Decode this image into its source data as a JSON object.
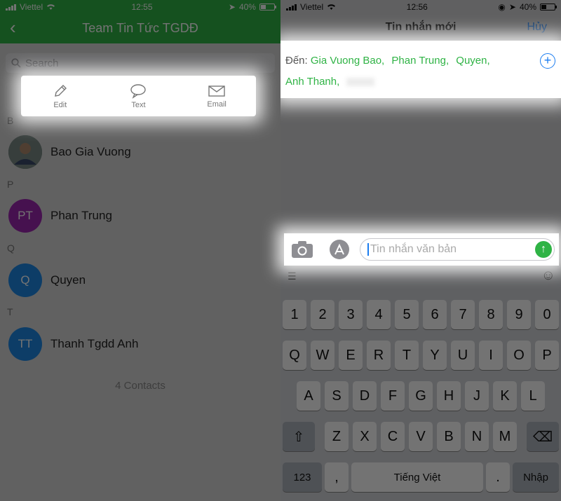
{
  "left": {
    "status": {
      "carrier": "Viettel",
      "time": "12:55",
      "battery": "40%"
    },
    "header": {
      "title": "Team Tin Tức TGDĐ",
      "back": "‹"
    },
    "search": {
      "placeholder": "Search"
    },
    "actions": [
      {
        "label": "Edit",
        "icon": "pencil-icon"
      },
      {
        "label": "Text",
        "icon": "chat-bubble-icon"
      },
      {
        "label": "Email",
        "icon": "envelope-icon"
      }
    ],
    "sections": [
      {
        "letter": "B",
        "contact": {
          "name": "Bao Gia Vuong",
          "initials": "",
          "color": "#6d7d7a",
          "photo": true
        }
      },
      {
        "letter": "P",
        "contact": {
          "name": "Phan Trung",
          "initials": "PT",
          "color": "#9c27b0",
          "photo": false
        }
      },
      {
        "letter": "Q",
        "contact": {
          "name": "Quyen",
          "initials": "Q",
          "color": "#1e88e5",
          "photo": false
        }
      },
      {
        "letter": "T",
        "contact": {
          "name": "Thanh Tgdd Anh",
          "initials": "TT",
          "color": "#1e88e5",
          "photo": false
        }
      }
    ],
    "contacts_count": "4 Contacts"
  },
  "right": {
    "status": {
      "carrier": "Viettel",
      "time": "12:56",
      "battery": "40%"
    },
    "nav": {
      "title": "Tin nhắn mới",
      "cancel": "Hủy"
    },
    "to": {
      "label": "Đến:",
      "recipients": [
        "Gia Vuong Bao,",
        "Phan Trung,",
        "Quyen,",
        "Anh Thanh,"
      ]
    },
    "compose": {
      "placeholder": "Tin nhắn văn bản"
    },
    "keyboard": {
      "row_numbers": [
        "1",
        "2",
        "3",
        "4",
        "5",
        "6",
        "7",
        "8",
        "9",
        "0"
      ],
      "row_q": [
        "Q",
        "W",
        "E",
        "R",
        "T",
        "Y",
        "U",
        "I",
        "O",
        "P"
      ],
      "row_a": [
        "A",
        "S",
        "D",
        "F",
        "G",
        "H",
        "J",
        "K",
        "L"
      ],
      "row_z": [
        "Z",
        "X",
        "C",
        "V",
        "B",
        "N",
        "M"
      ],
      "key_123": "123",
      "key_comma": ",",
      "key_space": "Tiếng Việt",
      "key_period": ".",
      "key_return": "Nhập"
    }
  },
  "colors": {
    "brand_green": "#2fb345",
    "ios_blue": "#1a7cf0"
  }
}
